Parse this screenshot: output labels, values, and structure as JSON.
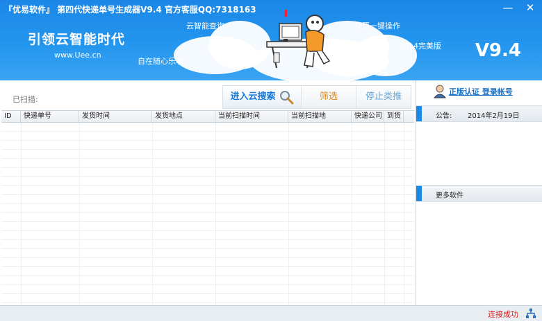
{
  "window": {
    "title": "『优易软件』 第四代快递单号生成器V9.4 官方客服QQ:7318163",
    "minimize_icon": "minimize-icon",
    "close_icon": "close-icon"
  },
  "banner": {
    "slogan": "引领云智能时代",
    "url": "www.Uee.cn",
    "tag_cloud_query": "云智能查询",
    "tag_one_click": "只要一键操作",
    "tag_anywhere": "自在随心乐享",
    "tag_edition": "2014完美版",
    "version": "V9.4"
  },
  "main": {
    "scanned_label": "已扫描:",
    "toolbar": {
      "cloud_search": "进入云搜索",
      "filter": "筛选",
      "stop_push": "停止类推"
    },
    "columns": [
      "ID",
      "快递单号",
      "发货时间",
      "发货地点",
      "当前扫描时间",
      "当前扫描地",
      "快递公司",
      "到货"
    ]
  },
  "side": {
    "login_label": "正版认证 登录帐号",
    "notice_label": "公告:",
    "notice_date": "2014年2月19日",
    "more_software": "更多软件"
  },
  "statusbar": {
    "message": "连接成功"
  },
  "colors": {
    "banner": "#2496ee",
    "accent": "#1e88e5",
    "status_ok": "#e0201b"
  }
}
